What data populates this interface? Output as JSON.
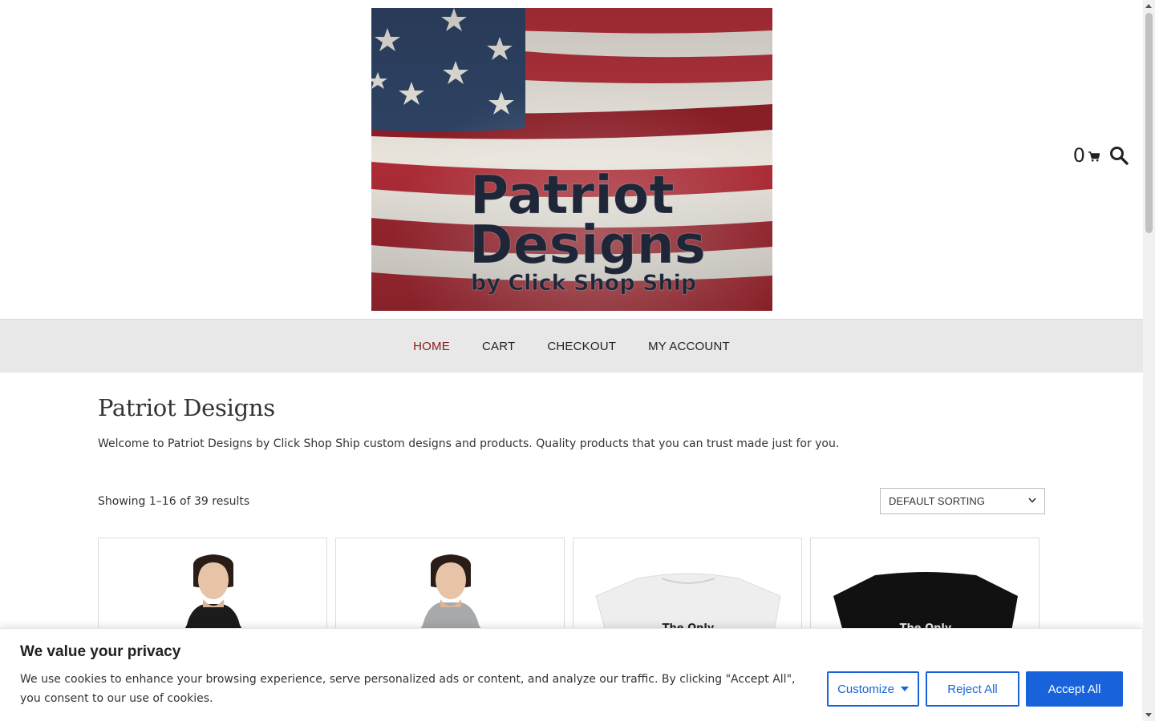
{
  "header": {
    "logo": {
      "line1": "Patriot",
      "line2": "Designs",
      "line3": "by Click Shop Ship"
    },
    "cart_count": "0",
    "icons": {
      "cart": "cart-icon",
      "search": "search-icon"
    }
  },
  "nav": {
    "items": [
      {
        "label": "HOME",
        "active": true
      },
      {
        "label": "CART"
      },
      {
        "label": "CHECKOUT"
      },
      {
        "label": "MY ACCOUNT"
      }
    ]
  },
  "main": {
    "title": "Patriot Designs",
    "intro": "Welcome to Patriot Designs by Click Shop Ship custom designs and products. Quality products that you can trust made just for you.",
    "result_count": "Showing 1–16 of 39 results",
    "sort": {
      "selected": "DEFAULT SORTING"
    },
    "products": [
      {
        "type": "hoodie",
        "color": "black"
      },
      {
        "type": "hoodie",
        "color": "gray"
      },
      {
        "type": "tshirt",
        "color": "white",
        "print": "The Only"
      },
      {
        "type": "tshirt",
        "color": "black",
        "print": "The Only"
      }
    ]
  },
  "cookie": {
    "title": "We value your privacy",
    "text": "We use cookies to enhance your browsing experience, serve personalized ads or content, and analyze our traffic. By clicking \"Accept All\", you consent to our use of cookies.",
    "customize_label": "Customize",
    "reject_label": "Reject All",
    "accept_label": "Accept All"
  },
  "colors": {
    "accent": "#1863dc",
    "nav_active": "#8b1a1a",
    "nav_bg": "#e8e8e8"
  }
}
